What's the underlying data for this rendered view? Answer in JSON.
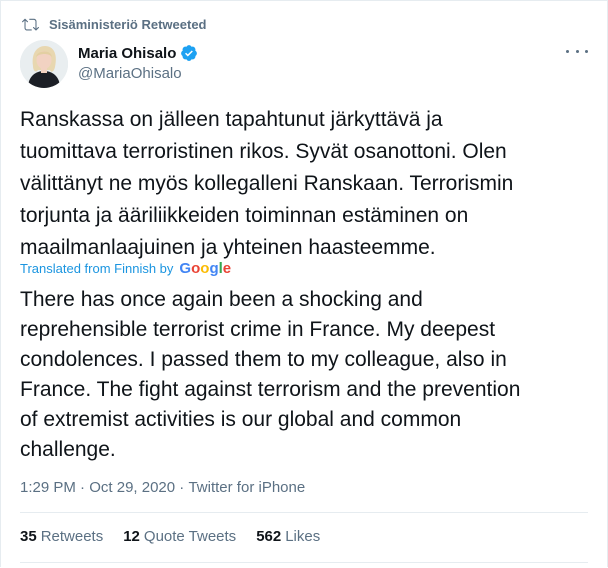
{
  "retweet": {
    "label": "Sisäministeriö Retweeted"
  },
  "author": {
    "name": "Maria Ohisalo",
    "handle": "@MariaOhisalo"
  },
  "tweet": {
    "text": "Ranskassa on jälleen tapahtunut järkyttävä ja\ntuomittava terroristinen rikos. Syvät osanottoni. Olen\nvälittänyt ne myös kollegalleni Ranskaan. Terrorismin\ntorjunta ja ääriliikkeiden toiminnan estäminen on\nmaailmanlaajuinen ja yhteinen haasteemme.",
    "translated_label": "Translated from Finnish by",
    "translator": "Google",
    "translation": "There has once again been a shocking and\nreprehensible terrorist crime in France. My deepest\ncondolences. I passed them to my colleague, also in\nFrance. The fight against terrorism and the prevention\nof extremist activities is our global and common\nchallenge."
  },
  "meta": {
    "time": "1:29 PM",
    "separator1": " · ",
    "date": "Oct 29, 2020",
    "separator2": " · ",
    "source": "Twitter for iPhone"
  },
  "stats": {
    "retweets_count": "35",
    "retweets_label": "Retweets",
    "quotes_count": "12",
    "quotes_label": "Quote Tweets",
    "likes_count": "562",
    "likes_label": "Likes"
  },
  "colors": {
    "accent": "#1b95e0",
    "secondary_text": "#5b7083",
    "verified": "#1da1f2"
  },
  "icons": {
    "retweet": "retweet-icon",
    "verified": "verified-badge-icon",
    "more": "more-icon"
  }
}
